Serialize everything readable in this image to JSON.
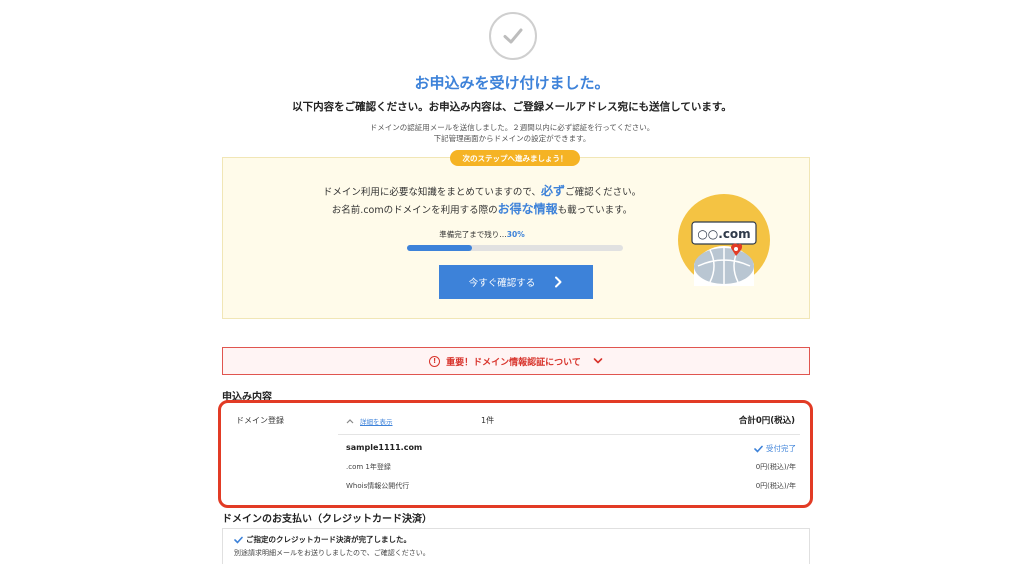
{
  "header": {
    "title": "お申込みを受け付けました。",
    "subtitle": "以下内容をご確認ください。お申込み内容は、ご登録メールアドレス宛にも送信しています。",
    "note_line1": "ドメインの認証用メールを送信しました。２週間以内に必ず認証を行ってください。",
    "note_line2": "下記管理画面からドメインの設定ができます。"
  },
  "next_step": {
    "badge": "次のステップへ進みましょう！",
    "line1_before": "ドメイン利用に必要な知識をまとめていますので、",
    "line1_emphasis": "必ず",
    "line1_after": "ご確認ください。",
    "line2_before": "お名前.comのドメインを利用する際の",
    "line2_emphasis": "お得な情報",
    "line2_after": "も載っています。",
    "progress_label": "準備完了まで残り…",
    "progress_pct": "30%",
    "progress_fraction": 0.3,
    "button_label": "今すぐ確認する",
    "illustration_text": "○○.com",
    "accent_color": "#3d82d9",
    "badge_color": "#f5b324"
  },
  "alert": {
    "label": "重要！ドメイン情報認証について",
    "icon": "exclamation-circle-icon",
    "color": "#d8342c"
  },
  "order": {
    "section_title": "申込み内容",
    "category": "ドメイン登録",
    "detail_link": "詳細を表示",
    "count": "1件",
    "total": "合計0円(税込)",
    "domain": "sample1111.com",
    "status": "受付完了",
    "rows": [
      {
        "label": ".com 1年登録",
        "price": "0円(税込)/年"
      },
      {
        "label": "Whois情報公開代行",
        "price": "0円(税込)/年"
      }
    ],
    "highlight_color": "#e23b25"
  },
  "payment": {
    "section_title": "ドメインのお支払い（クレジットカード決済）",
    "status_line": "ご指定のクレジットカード決済が完了しました。",
    "sub_line": "別途請求明細メールをお送りしましたので、ご確認ください。"
  }
}
